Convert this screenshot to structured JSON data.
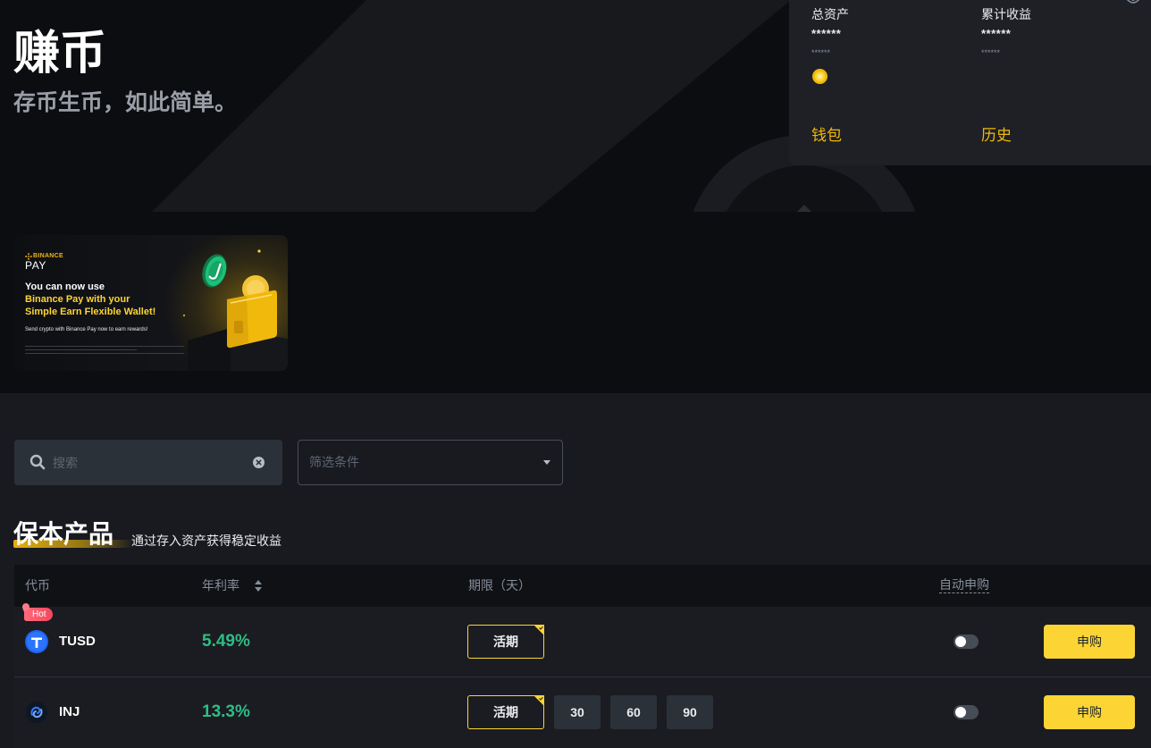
{
  "hero": {
    "title": "赚币",
    "subtitle": "存币生币，如此简单。"
  },
  "account": {
    "total_assets": {
      "label": "总资产",
      "value": "******",
      "sub_value": "******"
    },
    "cumulative_earnings": {
      "label": "累计收益",
      "value": "******",
      "sub_value": "******"
    },
    "wallet_link": "钱包",
    "history_link": "历史"
  },
  "banner": {
    "brand_top": "BINANCE",
    "brand_bottom": "PAY",
    "line1": "You can now use",
    "line2": "Binance Pay with your",
    "line3": "Simple Earn Flexible Wallet!",
    "caption": "Send crypto with Binance Pay now to earn rewards!"
  },
  "filters": {
    "search_placeholder": "搜索",
    "filter_placeholder": "筛选条件"
  },
  "section": {
    "title": "保本产品",
    "subtitle": "通过存入资产获得稳定收益"
  },
  "table": {
    "headers": {
      "coin": "代币",
      "apr": "年利率",
      "term": "期限（天）",
      "auto_subscribe": "自动申购"
    },
    "rows": [
      {
        "badge": "Hot",
        "coin": "TUSD",
        "icon": "tusd-icon",
        "apr": "5.49%",
        "terms": [
          "活期"
        ],
        "selected_term_index": 0,
        "auto_subscribe": false,
        "action": "申购"
      },
      {
        "coin": "INJ",
        "icon": "inj-icon",
        "apr": "13.3%",
        "terms": [
          "活期",
          "30",
          "60",
          "90"
        ],
        "selected_term_index": 0,
        "auto_subscribe": false,
        "action": "申购"
      }
    ]
  },
  "icons": {
    "search": "search-icon",
    "clear": "clear-icon",
    "dropdown": "chevron-down-icon",
    "sort": "sort-icon",
    "coin": "coin-icon",
    "eye": "eye-icon",
    "brand": "binance-logo-icon"
  },
  "colors": {
    "accent": "#fcd535",
    "link": "#f0b90b",
    "positive": "#2ebd85",
    "hot_badge": "#f6465d",
    "page_bg": "#181a20",
    "hero_bg": "#0c0d10",
    "card_bg": "#1e2026"
  }
}
